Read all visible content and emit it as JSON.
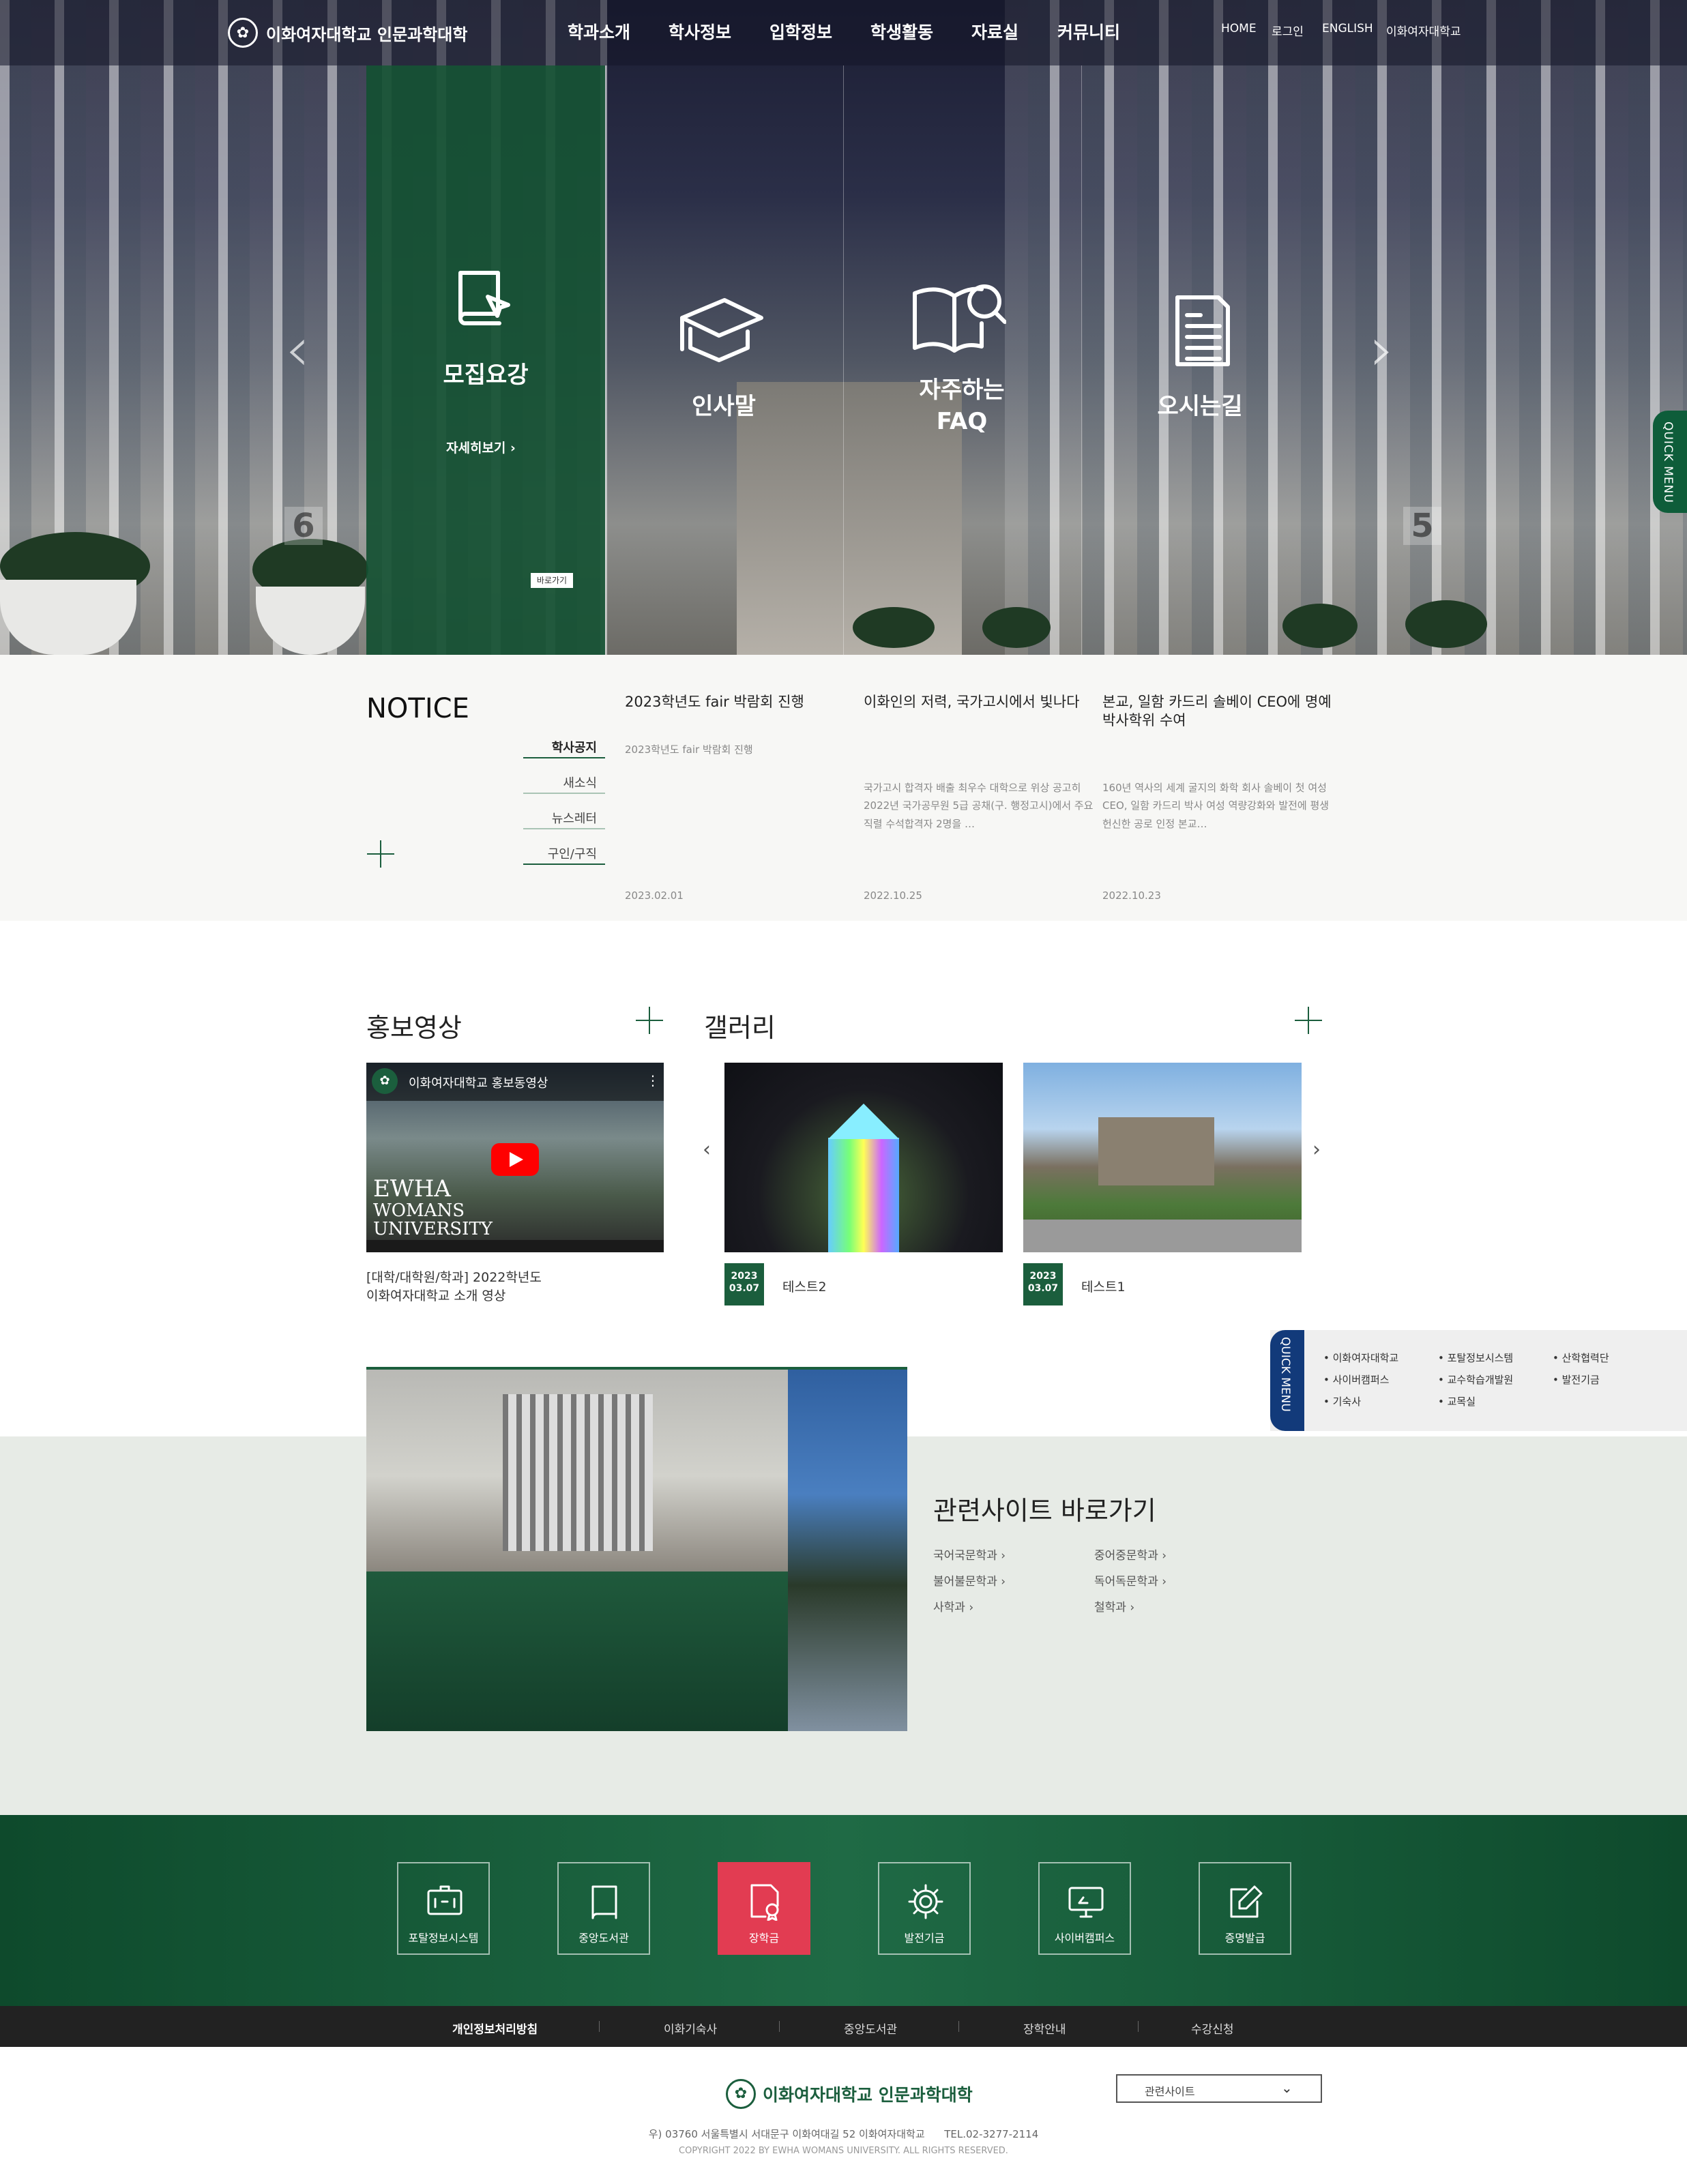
{
  "header": {
    "logo_text": "이화여자대학교 인문과학대학",
    "main_nav": [
      "학과소개",
      "학사정보",
      "입학정보",
      "학생활동",
      "자료실",
      "커뮤니티"
    ],
    "util_nav": [
      "HOME",
      "로그인",
      "ENGLISH",
      "이화여자대학교"
    ]
  },
  "hero": {
    "panels": [
      {
        "label": "모집요강",
        "icon": "book-pointer-icon"
      },
      {
        "label": "인사말",
        "icon": "graduation-cap-icon"
      },
      {
        "label": "자주하는\nFAQ",
        "icon": "open-book-search-icon"
      },
      {
        "label": "오시는길",
        "icon": "document-list-icon"
      }
    ],
    "more_label": "자세히보기",
    "shortcut_label": "바로가기",
    "slide_prev": "6",
    "slide_next": "5",
    "quick_menu": "QUICK MENU"
  },
  "notice": {
    "title": "NOTICE",
    "tabs": [
      "학사공지",
      "새소식",
      "뉴스레터",
      "구인/구직"
    ],
    "items": [
      {
        "title": "2023학년도 fair 박람회 진행",
        "body": "2023학년도 fair 박람회 진행",
        "date": "2023.02.01"
      },
      {
        "title": "이화인의 저력, 국가고시에서 빛나다",
        "body": "국가고시 합격자 배출 최우수 대학으로 위상 공고히 2022년 국가공무원 5급 공채(구. 행정고시)에서 주요 직렬 수석합격자 2명을 …",
        "date": "2022.10.25"
      },
      {
        "title": "본교, 일함 카드리 솔베이 CEO에 명예박사학위 수여",
        "body": "160년 역사의 세계 굴지의 화학 회사 솔베이 첫 여성 CEO, 일함 카드리 박사 여성 역량강화와 발전에 평생 헌신한 공로 인정 본교…",
        "date": "2022.10.23"
      }
    ]
  },
  "promo": {
    "title": "홍보영상",
    "video_title": "이화여자대학교 홍보동영상",
    "video_overlay": [
      "EWHA",
      "WOMANS",
      "UNIVERSITY"
    ],
    "caption": "[대학/대학원/학과] 2022학년도\n이화여자대학교 소개 영상"
  },
  "gallery": {
    "title": "갤러리",
    "items": [
      {
        "year": "2023",
        "day": "03.07",
        "label": "테스트2"
      },
      {
        "year": "2023",
        "day": "03.07",
        "label": "테스트1"
      }
    ]
  },
  "quick_menu2": {
    "tab": "QUICK MENU",
    "items": [
      "이화여자대학교",
      "포탈정보시스템",
      "산학협력단",
      "사이버캠퍼스",
      "교수학습개발원",
      "발전기금",
      "기숙사",
      "교목실"
    ]
  },
  "related": {
    "title": "관련사이트 바로가기",
    "links": [
      "국어국문학과",
      "중어중문학과",
      "불어불문학과",
      "독어독문학과",
      "사학과",
      "철학과"
    ]
  },
  "footer_icons": [
    {
      "label": "포탈정보시스템",
      "icon": "id-card-icon"
    },
    {
      "label": "중앙도서관",
      "icon": "book-icon"
    },
    {
      "label": "장학금",
      "icon": "certificate-icon",
      "highlight": true
    },
    {
      "label": "발전기금",
      "icon": "gear-icon"
    },
    {
      "label": "사이버캠퍼스",
      "icon": "monitor-icon"
    },
    {
      "label": "증명발급",
      "icon": "edit-icon"
    }
  ],
  "footer_links": [
    "개인정보처리방침",
    "이화기숙사",
    "중앙도서관",
    "장학안내",
    "수강신청"
  ],
  "footer": {
    "logo_text": "이화여자대학교 인문과학대학",
    "select_label": "관련사이트",
    "address": "우) 03760 서울특별시 서대문구 이화여대길 52 이화여자대학교      TEL.02-3277-2114",
    "copyright": "COPYRIGHT 2022 BY EWHA WOMANS UNIVERSITY. ALL RIGHTS RESERVED."
  },
  "colors": {
    "brand_green": "#1b5e3d",
    "accent_red": "#e23c52",
    "quick_blue": "#123a7a"
  }
}
